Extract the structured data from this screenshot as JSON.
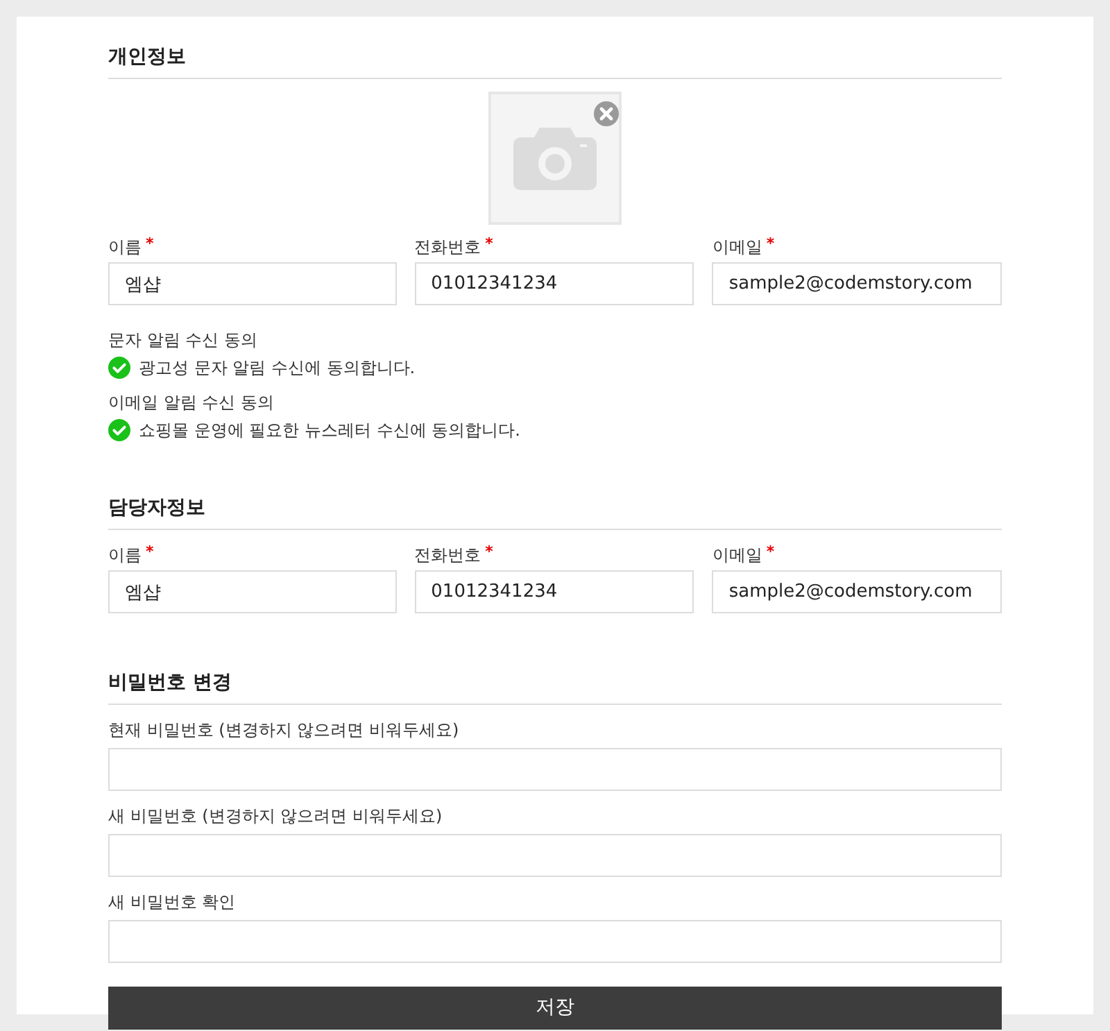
{
  "sections": [
    {
      "title": "개인정보",
      "photo": {
        "kind": "placeholder"
      },
      "fields": [
        {
          "label": "이름",
          "required_mark": "*",
          "value": "엠샵"
        },
        {
          "label": "전화번호",
          "required_mark": "*",
          "value": "01012341234"
        },
        {
          "label": "이메일",
          "required_mark": "*",
          "value": "sample2@codemstory.com"
        }
      ],
      "consents": [
        {
          "label": "문자 알림 수신 동의",
          "text": "광고성 문자 알림 수신에 동의합니다.",
          "checked": true
        },
        {
          "label": "이메일 알림 수신 동의",
          "text": "쇼핑몰 운영에 필요한 뉴스레터 수신에 동의합니다.",
          "checked": true
        }
      ]
    },
    {
      "title": "담당자정보",
      "fields": [
        {
          "label": "이름",
          "required_mark": "*",
          "value": "엠샵"
        },
        {
          "label": "전화번호",
          "required_mark": "*",
          "value": "01012341234"
        },
        {
          "label": "이메일",
          "required_mark": "*",
          "value": "sample2@codemstory.com"
        }
      ]
    },
    {
      "title": "비밀번호 변경",
      "password_fields": [
        {
          "label": "현재 비밀번호 (변경하지 않으려면 비워두세요)"
        },
        {
          "label": "새 비밀번호 (변경하지 않으려면 비워두세요)"
        },
        {
          "label": "새 비밀번호 확인"
        }
      ]
    }
  ],
  "save_button": "저장"
}
